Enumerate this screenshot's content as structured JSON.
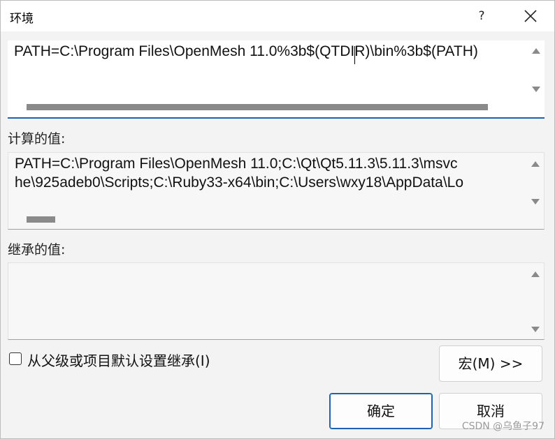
{
  "window": {
    "title": "环境",
    "help_label": "?",
    "close_icon": "close-icon"
  },
  "edit": {
    "value": "PATH=C:\\Program Files\\OpenMesh 11.0%3b$(QTDIR)\\bin%3b$(PATH)"
  },
  "computed": {
    "label": "计算的值:",
    "line1": "PATH=C:\\Program Files\\OpenMesh 11.0;C:\\Qt\\Qt5.11.3\\5.11.3\\msvc",
    "line2": "he\\925adeb0\\Scripts;C:\\Ruby33-x64\\bin;C:\\Users\\wxy18\\AppData\\Lo"
  },
  "inherited": {
    "label": "继承的值:"
  },
  "inherit_checkbox": {
    "label": "从父级或项目默认设置继承(I)",
    "checked": false
  },
  "buttons": {
    "macro": "宏(M) >>",
    "ok": "确定",
    "cancel": "取消"
  },
  "watermark": "CSDN @乌鱼子97",
  "colors": {
    "accent": "#1a63b0",
    "scrollbar": "#8a8a8a",
    "background": "#f3f3f3"
  }
}
